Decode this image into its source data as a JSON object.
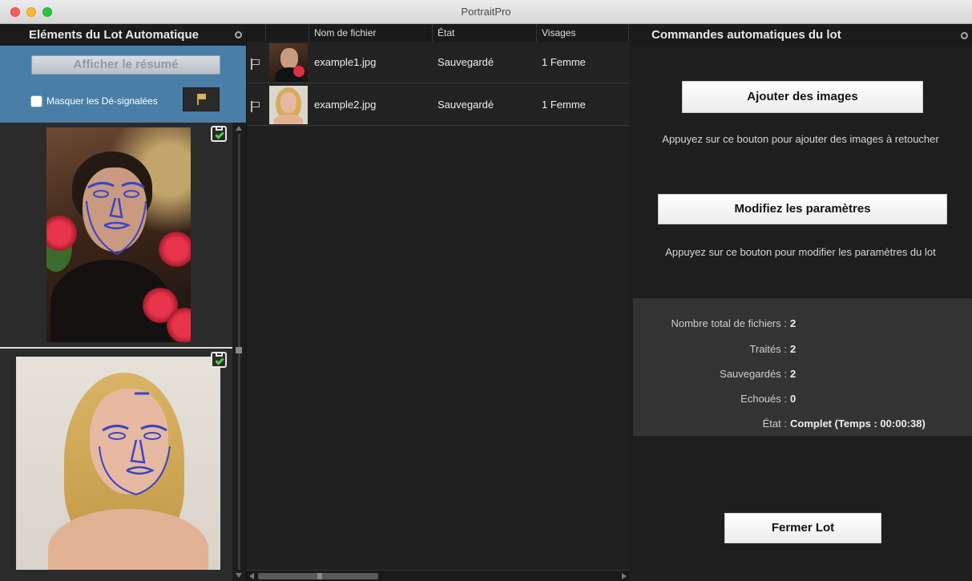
{
  "window": {
    "title": "PortraitPro"
  },
  "left_panel": {
    "title": "Eléments du Lot Automatique",
    "summary_button": "Afficher le résumé",
    "hide_unflagged_label": "Masquer les Dé-signalées",
    "hide_unflagged_checked": false
  },
  "file_table": {
    "columns": [
      "",
      "",
      "Nom de fichier",
      "État",
      "Visages"
    ],
    "rows": [
      {
        "filename": "example1.jpg",
        "state": "Sauvegardé",
        "faces": "1 Femme"
      },
      {
        "filename": "example2.jpg",
        "state": "Sauvegardé",
        "faces": "1 Femme"
      }
    ]
  },
  "right_panel": {
    "title": "Commandes automatiques du lot",
    "add_images_button": "Ajouter des images",
    "add_images_hint": "Appuyez sur ce bouton pour ajouter des images à retoucher",
    "modify_settings_button": "Modifiez les paramètres",
    "modify_settings_hint": "Appuyez sur ce bouton pour modifier les paramètres du lot",
    "stats": [
      {
        "label": "Nombre total de fichiers :",
        "value": "2"
      },
      {
        "label": "Traités :",
        "value": "2"
      },
      {
        "label": "Sauvegardés :",
        "value": "2"
      },
      {
        "label": "Echoués :",
        "value": "0"
      },
      {
        "label": "État :",
        "value": "Complet (Temps : 00:00:38)"
      }
    ],
    "close_button": "Fermer Lot"
  },
  "icons": {
    "window_controls": [
      "close-icon",
      "minimize-icon",
      "zoom-icon"
    ],
    "panel_options": "gear-icon",
    "flag": "flag-icon",
    "saved": "saved-check-icon"
  },
  "colors": {
    "panel_blue": "#4a7ea6",
    "saved_check": "#4fcf4b",
    "flag_gold": "#d9b55a"
  }
}
